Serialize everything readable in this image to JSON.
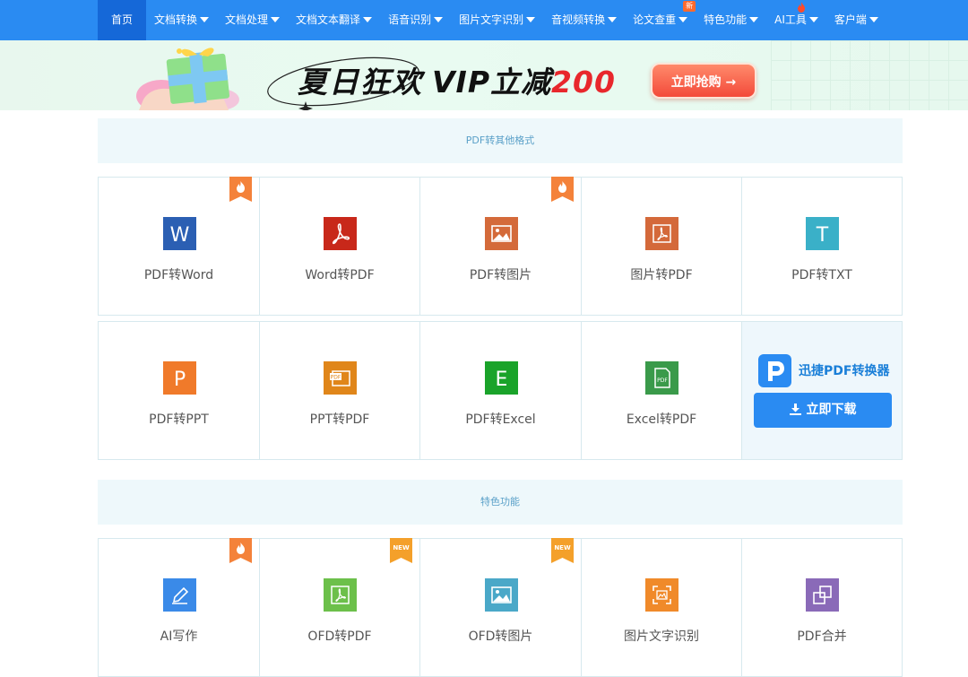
{
  "nav": {
    "items": [
      {
        "label": "首页",
        "active": true,
        "dropdown": false
      },
      {
        "label": "文档转换",
        "dropdown": true
      },
      {
        "label": "文档处理",
        "dropdown": true
      },
      {
        "label": "文档文本翻译",
        "dropdown": true
      },
      {
        "label": "语音识别",
        "dropdown": true
      },
      {
        "label": "图片文字识别",
        "dropdown": true
      },
      {
        "label": "音视频转换",
        "dropdown": true
      },
      {
        "label": "论文查重",
        "dropdown": true,
        "badge": "新"
      },
      {
        "label": "特色功能",
        "dropdown": true
      },
      {
        "label": "AI工具",
        "dropdown": true,
        "hot": true
      },
      {
        "label": "客户端",
        "dropdown": true
      }
    ]
  },
  "banner": {
    "headline": "夏日狂欢",
    "vip_prefix": "VIP立减",
    "vip_amount": "200",
    "cta": "立即抢购 →"
  },
  "sections": [
    {
      "title": "PDF转其他格式",
      "rows": [
        [
          {
            "label": "PDF转Word",
            "icon": "word-icon",
            "color": "#2b5fb3",
            "ribbon": "hot"
          },
          {
            "label": "Word转PDF",
            "icon": "pdf-icon",
            "color": "#c8281a"
          },
          {
            "label": "PDF转图片",
            "icon": "image-icon",
            "color": "#d46a3a",
            "ribbon": "hot"
          },
          {
            "label": "图片转PDF",
            "icon": "pdf-image-icon",
            "color": "#d4693a"
          },
          {
            "label": "PDF转TXT",
            "icon": "txt-icon",
            "color": "#3ab0c8"
          }
        ],
        [
          {
            "label": "PDF转PPT",
            "icon": "ppt-icon",
            "color": "#f07a2a"
          },
          {
            "label": "PPT转PDF",
            "icon": "ppt-pdf-icon",
            "color": "#e0861a"
          },
          {
            "label": "PDF转Excel",
            "icon": "excel-icon",
            "color": "#1aa32a"
          },
          {
            "label": "Excel转PDF",
            "icon": "excel-pdf-icon",
            "color": "#3a9a4a"
          }
        ]
      ],
      "promo": {
        "title": "迅捷PDF转换器",
        "button": "立即下载"
      }
    },
    {
      "title": "特色功能",
      "rows": [
        [
          {
            "label": "AI写作",
            "icon": "ai-write-icon",
            "color": "#3a8ae8",
            "ribbon": "hot"
          },
          {
            "label": "OFD转PDF",
            "icon": "ofd-pdf-icon",
            "color": "#6cc04a",
            "ribbon": "NEW"
          },
          {
            "label": "OFD转图片",
            "icon": "ofd-image-icon",
            "color": "#4aa8c8",
            "ribbon": "NEW"
          },
          {
            "label": "图片文字识别",
            "icon": "ocr-icon",
            "color": "#f08a2a"
          },
          {
            "label": "PDF合并",
            "icon": "merge-icon",
            "color": "#8a6ab8"
          }
        ]
      ]
    }
  ]
}
